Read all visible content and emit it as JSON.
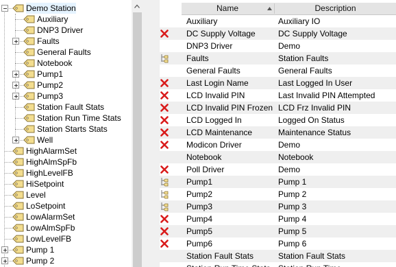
{
  "tree": {
    "items": [
      {
        "label": "Demo Station",
        "level": 0,
        "expander": "minus",
        "selected": true
      },
      {
        "label": "Auxiliary",
        "level": 1,
        "expander": "none"
      },
      {
        "label": "DNP3 Driver",
        "level": 1,
        "expander": "none"
      },
      {
        "label": "Faults",
        "level": 1,
        "expander": "plus"
      },
      {
        "label": "General Faults",
        "level": 1,
        "expander": "none"
      },
      {
        "label": "Notebook",
        "level": 1,
        "expander": "none"
      },
      {
        "label": "Pump1",
        "level": 1,
        "expander": "plus"
      },
      {
        "label": "Pump2",
        "level": 1,
        "expander": "plus"
      },
      {
        "label": "Pump3",
        "level": 1,
        "expander": "plus"
      },
      {
        "label": "Station Fault Stats",
        "level": 1,
        "expander": "none"
      },
      {
        "label": "Station Run Time Stats",
        "level": 1,
        "expander": "none"
      },
      {
        "label": "Station Starts Stats",
        "level": 1,
        "expander": "none"
      },
      {
        "label": "Well",
        "level": 1,
        "expander": "plus"
      },
      {
        "label": "HighAlarmSet",
        "level": 0,
        "expander": "none"
      },
      {
        "label": "HighAlmSpFb",
        "level": 0,
        "expander": "none"
      },
      {
        "label": "HighLevelFB",
        "level": 0,
        "expander": "none"
      },
      {
        "label": "HiSetpoint",
        "level": 0,
        "expander": "none"
      },
      {
        "label": "Level",
        "level": 0,
        "expander": "none"
      },
      {
        "label": "LoSetpoint",
        "level": 0,
        "expander": "none"
      },
      {
        "label": "LowAlarmSet",
        "level": 0,
        "expander": "none"
      },
      {
        "label": "LowAlmSpFb",
        "level": 0,
        "expander": "none"
      },
      {
        "label": "LowLevelFB",
        "level": 0,
        "expander": "none"
      },
      {
        "label": "Pump 1",
        "level": 0,
        "expander": "plus"
      },
      {
        "label": "Pump 2",
        "level": 0,
        "expander": "plus"
      }
    ]
  },
  "grid": {
    "columns": {
      "name": "Name",
      "description": "Description"
    },
    "sort": "name-ascending",
    "rows": [
      {
        "icon": "none",
        "name": "Auxiliary",
        "description": "Auxiliary IO"
      },
      {
        "icon": "red-x-icon",
        "name": "DC Supply Voltage",
        "description": "DC Supply Voltage"
      },
      {
        "icon": "none",
        "name": "DNP3 Driver",
        "description": "Demo"
      },
      {
        "icon": "tag-group-icon",
        "name": "Faults",
        "description": "Station Faults"
      },
      {
        "icon": "none",
        "name": "General Faults",
        "description": "General Faults"
      },
      {
        "icon": "red-x-icon",
        "name": "Last Login Name",
        "description": "Last Logged In User"
      },
      {
        "icon": "red-x-icon",
        "name": "LCD Invalid PIN",
        "description": "Last Invalid PIN Attempted"
      },
      {
        "icon": "red-x-icon",
        "name": "LCD Invalid PIN Frozen",
        "description": "LCD Frz Invalid PIN"
      },
      {
        "icon": "red-x-icon",
        "name": "LCD Logged In",
        "description": "Logged On Status"
      },
      {
        "icon": "red-x-icon",
        "name": "LCD Maintenance",
        "description": "Maintenance Status"
      },
      {
        "icon": "red-x-icon",
        "name": "Modicon Driver",
        "description": "Demo"
      },
      {
        "icon": "none",
        "name": "Notebook",
        "description": "Notebook"
      },
      {
        "icon": "red-x-icon",
        "name": "Poll Driver",
        "description": "Demo"
      },
      {
        "icon": "tag-group-icon",
        "name": "Pump1",
        "description": "Pump 1"
      },
      {
        "icon": "tag-group-icon",
        "name": "Pump2",
        "description": "Pump 2"
      },
      {
        "icon": "tag-group-icon",
        "name": "Pump3",
        "description": "Pump 3"
      },
      {
        "icon": "red-x-icon",
        "name": "Pump4",
        "description": "Pump 4"
      },
      {
        "icon": "red-x-icon",
        "name": "Pump5",
        "description": "Pump 5"
      },
      {
        "icon": "red-x-icon",
        "name": "Pump6",
        "description": "Pump 6"
      },
      {
        "icon": "none",
        "name": "Station Fault Stats",
        "description": "Station Fault Stats"
      },
      {
        "icon": "none",
        "name": "Station Run Time Stats",
        "description": "Station Run Time"
      }
    ]
  },
  "colors": {
    "selection": "#e5f3ff",
    "row_alt": "#efefef",
    "header": "#e4e4e4",
    "error": "#d91b1b",
    "tag": "#f0d98c"
  }
}
